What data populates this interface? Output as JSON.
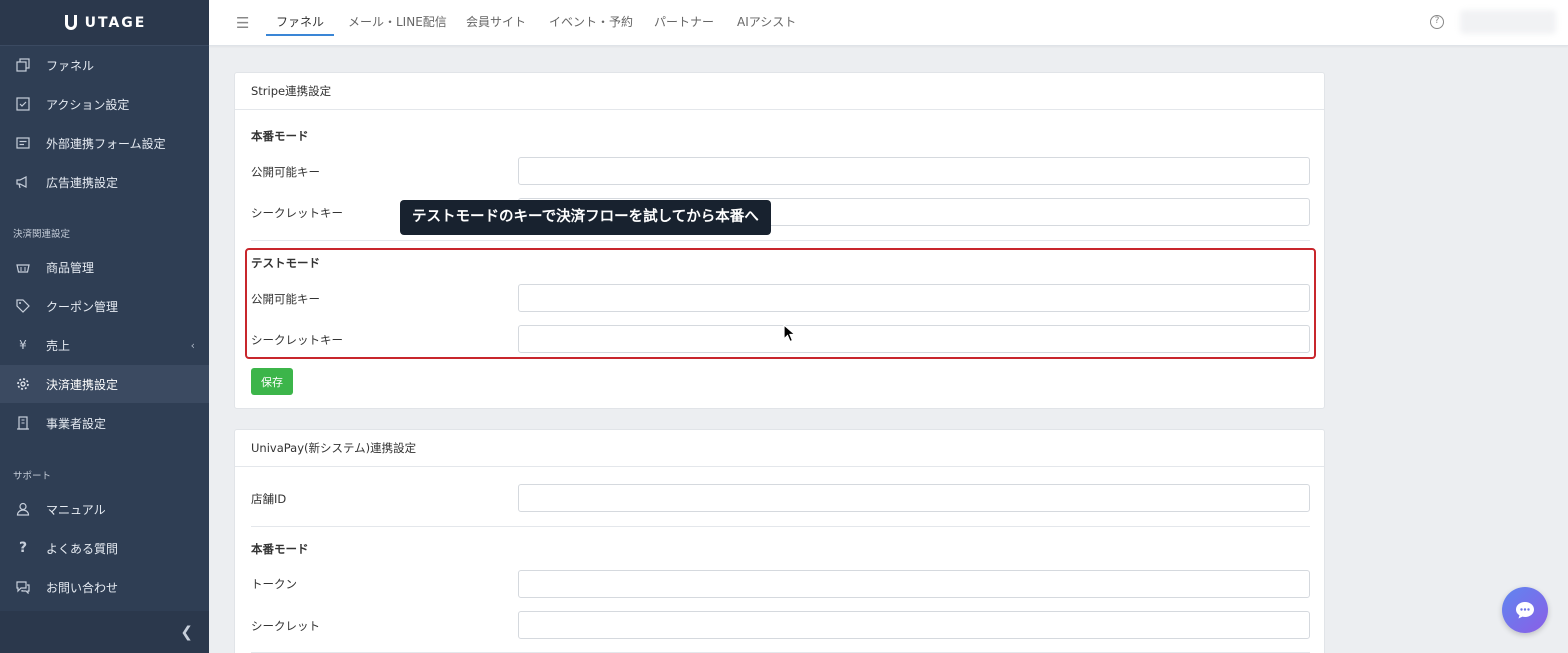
{
  "brand": {
    "name": "UTAGE"
  },
  "sidebar": {
    "items_top": [
      {
        "label": "ファネル",
        "icon": "copy-icon"
      },
      {
        "label": "アクション設定",
        "icon": "checkbox-icon"
      },
      {
        "label": "外部連携フォーム設定",
        "icon": "form-icon"
      },
      {
        "label": "広告連携設定",
        "icon": "megaphone-icon"
      }
    ],
    "section_payment": "決済関連設定",
    "items_payment": [
      {
        "label": "商品管理",
        "icon": "basket-icon"
      },
      {
        "label": "クーポン管理",
        "icon": "tag-icon"
      },
      {
        "label": "売上",
        "icon": "yen-icon"
      },
      {
        "label": "決済連携設定",
        "icon": "gear-icon"
      },
      {
        "label": "事業者設定",
        "icon": "building-icon"
      }
    ],
    "section_support": "サポート",
    "items_support": [
      {
        "label": "マニュアル",
        "icon": "person-icon"
      },
      {
        "label": "よくある質問",
        "icon": "question-icon"
      },
      {
        "label": "お問い合わせ",
        "icon": "chat-icon"
      }
    ]
  },
  "topnav": {
    "tabs": [
      "ファネル",
      "メール・LINE配信",
      "会員サイト",
      "イベント・予約",
      "パートナー",
      "AIアシスト"
    ],
    "active": "ファネル"
  },
  "stripe": {
    "title": "Stripe連携設定",
    "live": {
      "title": "本番モード",
      "publishable_label": "公開可能キー",
      "secret_label": "シークレットキー",
      "publishable_value": "",
      "secret_value": ""
    },
    "test": {
      "title": "テストモード",
      "publishable_label": "公開可能キー",
      "secret_label": "シークレットキー",
      "publishable_value": "",
      "secret_value": ""
    },
    "save_label": "保存"
  },
  "univapay": {
    "title": "UnivaPay(新システム)連携設定",
    "store_id_label": "店舗ID",
    "store_id_value": "",
    "live": {
      "title": "本番モード",
      "token_label": "トークン",
      "secret_label": "シークレット",
      "token_value": "",
      "secret_value": ""
    }
  },
  "tooltip": {
    "text": "テストモードのキーで決済フローを試してから本番へ"
  },
  "colors": {
    "sidebar_bg": "#2f3e54",
    "accent": "#3a86d6",
    "save": "#3cb54a",
    "highlight": "#c8262c",
    "tooltip_bg": "#18222f"
  }
}
